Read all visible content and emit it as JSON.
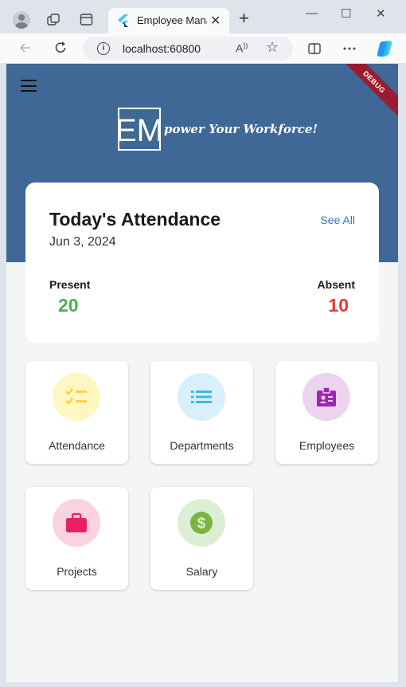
{
  "browser": {
    "tab_title": "Employee Management",
    "url": "localhost:60800",
    "read_aloud_label": "A"
  },
  "app": {
    "debug_banner": "DEBUG",
    "logo_text": "EM",
    "tagline": "power Your Workforce!",
    "attendance": {
      "title": "Today's Attendance",
      "date": "Jun 3, 2024",
      "see_all": "See All",
      "present_label": "Present",
      "present_value": "20",
      "absent_label": "Absent",
      "absent_value": "10"
    },
    "tiles": [
      {
        "label": "Attendance",
        "icon": "checklist-icon",
        "bg": "#fff7c2",
        "fg": "#f6d53b"
      },
      {
        "label": "Departments",
        "icon": "list-icon",
        "bg": "#d7f0fb",
        "fg": "#3fb6ea"
      },
      {
        "label": "Employees",
        "icon": "badge-icon",
        "bg": "#ecd3ef",
        "fg": "#9c27b0"
      },
      {
        "label": "Projects",
        "icon": "briefcase-icon",
        "bg": "#fbd2e0",
        "fg": "#e91e63"
      },
      {
        "label": "Salary",
        "icon": "dollar-icon",
        "bg": "#dcefd4",
        "fg": "#7cb342"
      }
    ]
  },
  "colors": {
    "hero": "#3f6896",
    "present": "#4caf50",
    "absent": "#e53935",
    "link": "#2f74c0"
  }
}
